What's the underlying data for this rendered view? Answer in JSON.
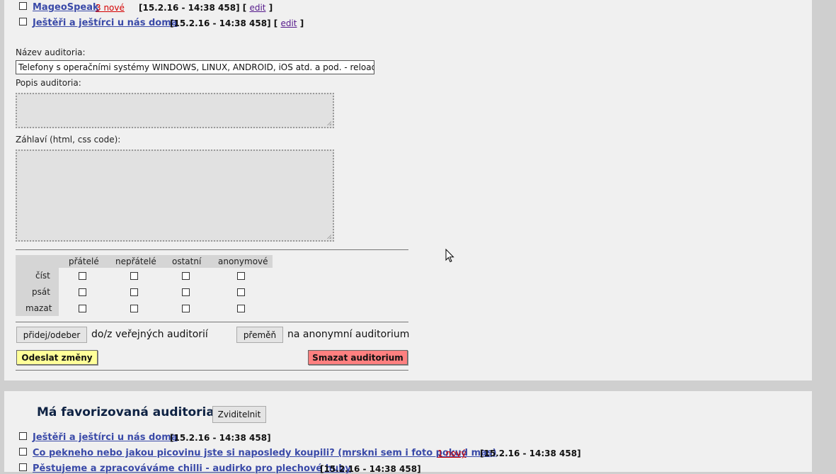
{
  "auditoria_list": [
    {
      "name": "MageoSpeak",
      "new_badge": "3 nové",
      "timestamp": "[15.2.16 - 14:38 458]",
      "edit_open": "[",
      "edit": "edit",
      "edit_close": "]"
    },
    {
      "name": "Ještěři a ještírci u nás doma",
      "timestamp": "[15.2.16 - 14:38 458]",
      "edit_open": "[",
      "edit": "edit",
      "edit_close": "]"
    }
  ],
  "form": {
    "name_label": "Název auditoria:",
    "name_value": "Telefony s operačními systémy WINDOWS, LINUX, ANDROID, iOS atd. a pod. - reloaded",
    "description_label": "Popis auditoria:",
    "description_value": "",
    "header_label": "Záhlaví (html, css code):",
    "header_value": ""
  },
  "permissions": {
    "columns": [
      "přátelé",
      "nepřátelé",
      "ostatní",
      "anonymové"
    ],
    "rows": [
      "číst",
      "psát",
      "mazat"
    ]
  },
  "actions": {
    "add_remove_button": "přidej/odeber",
    "add_remove_text": "do/z veřejných auditorií",
    "convert_button": "přeměň",
    "convert_text": "na anonymní auditorium",
    "submit_button": "Odeslat změny",
    "delete_button": "Smazat auditorium"
  },
  "favorites": {
    "title": "Má favorizovaná auditoria",
    "show_button": "Zviditelnit",
    "items": [
      {
        "name": "Ještěři a ještírci u nás doma",
        "timestamp": "[15.2.16 - 14:38 458]"
      },
      {
        "name": "Co pekneho nebo jakou picovinu jste si naposledy koupili? (mrskni sem i foto pokud mas)",
        "new_badge": "1 nový",
        "timestamp": "[15.2.16 - 14:38 458]"
      },
      {
        "name": "Pěstujeme a zpracováváme chilli - audirko pro plechové huby",
        "timestamp": "[15.2.16 - 14:38 458]"
      }
    ]
  }
}
